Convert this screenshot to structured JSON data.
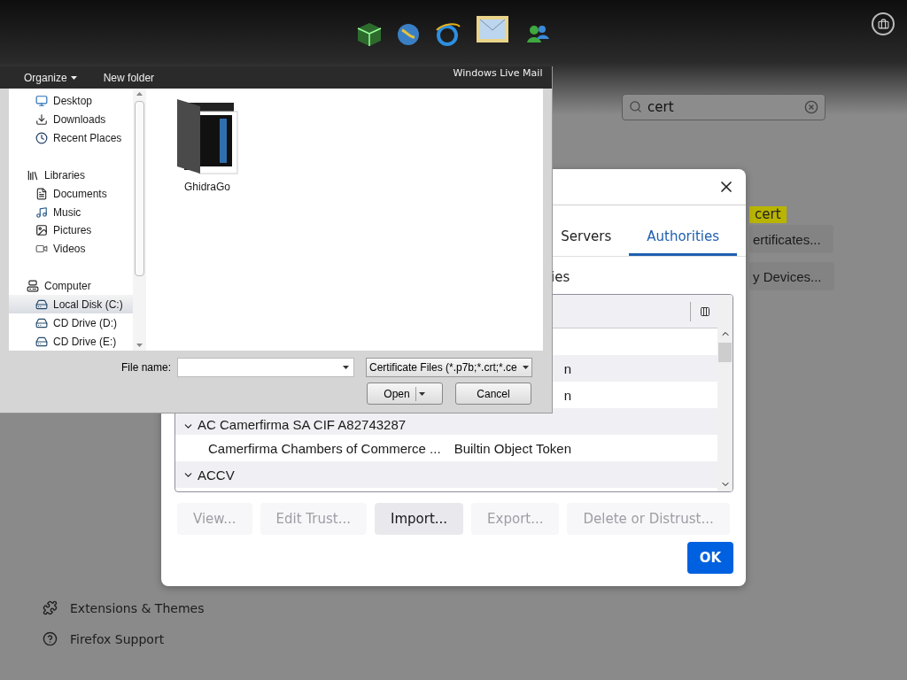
{
  "browser_page": {
    "search": {
      "value": "cert"
    },
    "highlight": "cert",
    "buttons": [
      "ertificates...",
      "y Devices..."
    ],
    "links": [
      "Extensions & Themes",
      "Firefox Support"
    ]
  },
  "dock": {
    "label": "Windows Live Mail"
  },
  "cert_dialog": {
    "tabs": [
      {
        "label": "Servers",
        "selected": false
      },
      {
        "label": "Authorities",
        "selected": true
      }
    ],
    "caption": "ies",
    "rows": [
      {
        "kind": "cert"
      },
      {
        "kind": "group_tail",
        "text": "n"
      },
      {
        "kind": "cert",
        "token": "n"
      },
      {
        "kind": "group",
        "text": "AC Camerfirma SA CIF A82743287",
        "expanded": true
      },
      {
        "kind": "cert",
        "name": "Camerfirma Chambers of Commerce ...",
        "token": "Builtin Object Token"
      },
      {
        "kind": "group",
        "text": "ACCV",
        "expanded": true
      }
    ],
    "buttons": [
      {
        "label": "View...",
        "disabled": true
      },
      {
        "label": "Edit Trust...",
        "disabled": true
      },
      {
        "label": "Import...",
        "disabled": false
      },
      {
        "label": "Export...",
        "disabled": true
      },
      {
        "label": "Delete or Distrust...",
        "disabled": true
      }
    ],
    "ok": "OK"
  },
  "file_dialog": {
    "toolbar": [
      {
        "label": "Organize",
        "menu": true
      },
      {
        "label": "New folder",
        "menu": false
      }
    ],
    "nav": [
      {
        "label": "Desktop",
        "selected": false
      },
      {
        "label": "Downloads",
        "selected": false
      },
      {
        "label": "Recent Places",
        "selected": false
      },
      {
        "label": "Libraries",
        "selected": false,
        "children": [
          {
            "label": "Documents",
            "selected": false
          },
          {
            "label": "Music",
            "selected": false
          },
          {
            "label": "Pictures",
            "selected": false
          },
          {
            "label": "Videos",
            "selected": false
          }
        ]
      },
      {
        "label": "Computer",
        "selected": false,
        "children": [
          {
            "label": "Local Disk (C:)",
            "selected": true
          },
          {
            "label": "CD Drive (D:)",
            "selected": false
          },
          {
            "label": "CD Drive (E:)",
            "selected": false
          }
        ]
      }
    ],
    "files": [
      {
        "name": "GhidraGo"
      }
    ],
    "file_name_label": "File name:",
    "filter": "Certificate Files (*.p7b;*.crt;*.ce",
    "open": "Open",
    "cancel": "Cancel"
  }
}
